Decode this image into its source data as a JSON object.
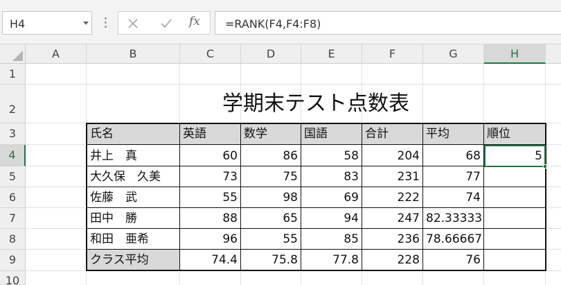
{
  "formula_bar": {
    "name_box": "H4",
    "cancel_icon": "close-icon",
    "enter_icon": "check-icon",
    "function_label": "fx",
    "formula": "=RANK(F4,F4:F8)"
  },
  "columns": [
    "A",
    "B",
    "C",
    "D",
    "E",
    "F",
    "G",
    "H"
  ],
  "rows": [
    "1",
    "2",
    "3",
    "4",
    "5",
    "6",
    "7",
    "8",
    "9",
    "10"
  ],
  "selected_cell": "H4",
  "sheet": {
    "title": "学期末テスト点数表",
    "headers": [
      "氏名",
      "英語",
      "数学",
      "国語",
      "合計",
      "平均",
      "順位"
    ],
    "students": [
      {
        "name": "井上　真",
        "english": "60",
        "math": "86",
        "japanese": "58",
        "total": "204",
        "average": "68",
        "rank": "5"
      },
      {
        "name": "大久保　久美",
        "english": "73",
        "math": "75",
        "japanese": "83",
        "total": "231",
        "average": "77",
        "rank": ""
      },
      {
        "name": "佐藤　武",
        "english": "55",
        "math": "98",
        "japanese": "69",
        "total": "222",
        "average": "74",
        "rank": ""
      },
      {
        "name": "田中　勝",
        "english": "88",
        "math": "65",
        "japanese": "94",
        "total": "247",
        "average": "82.33333",
        "rank": ""
      },
      {
        "name": "和田　亜希",
        "english": "96",
        "math": "55",
        "japanese": "85",
        "total": "236",
        "average": "78.66667",
        "rank": ""
      }
    ],
    "class_average": {
      "label": "クラス平均",
      "english": "74.4",
      "math": "75.8",
      "japanese": "77.8",
      "total": "228",
      "average": "76",
      "rank": ""
    }
  },
  "colors": {
    "selection": "#217346",
    "header_fill": "#d9d9d9"
  }
}
